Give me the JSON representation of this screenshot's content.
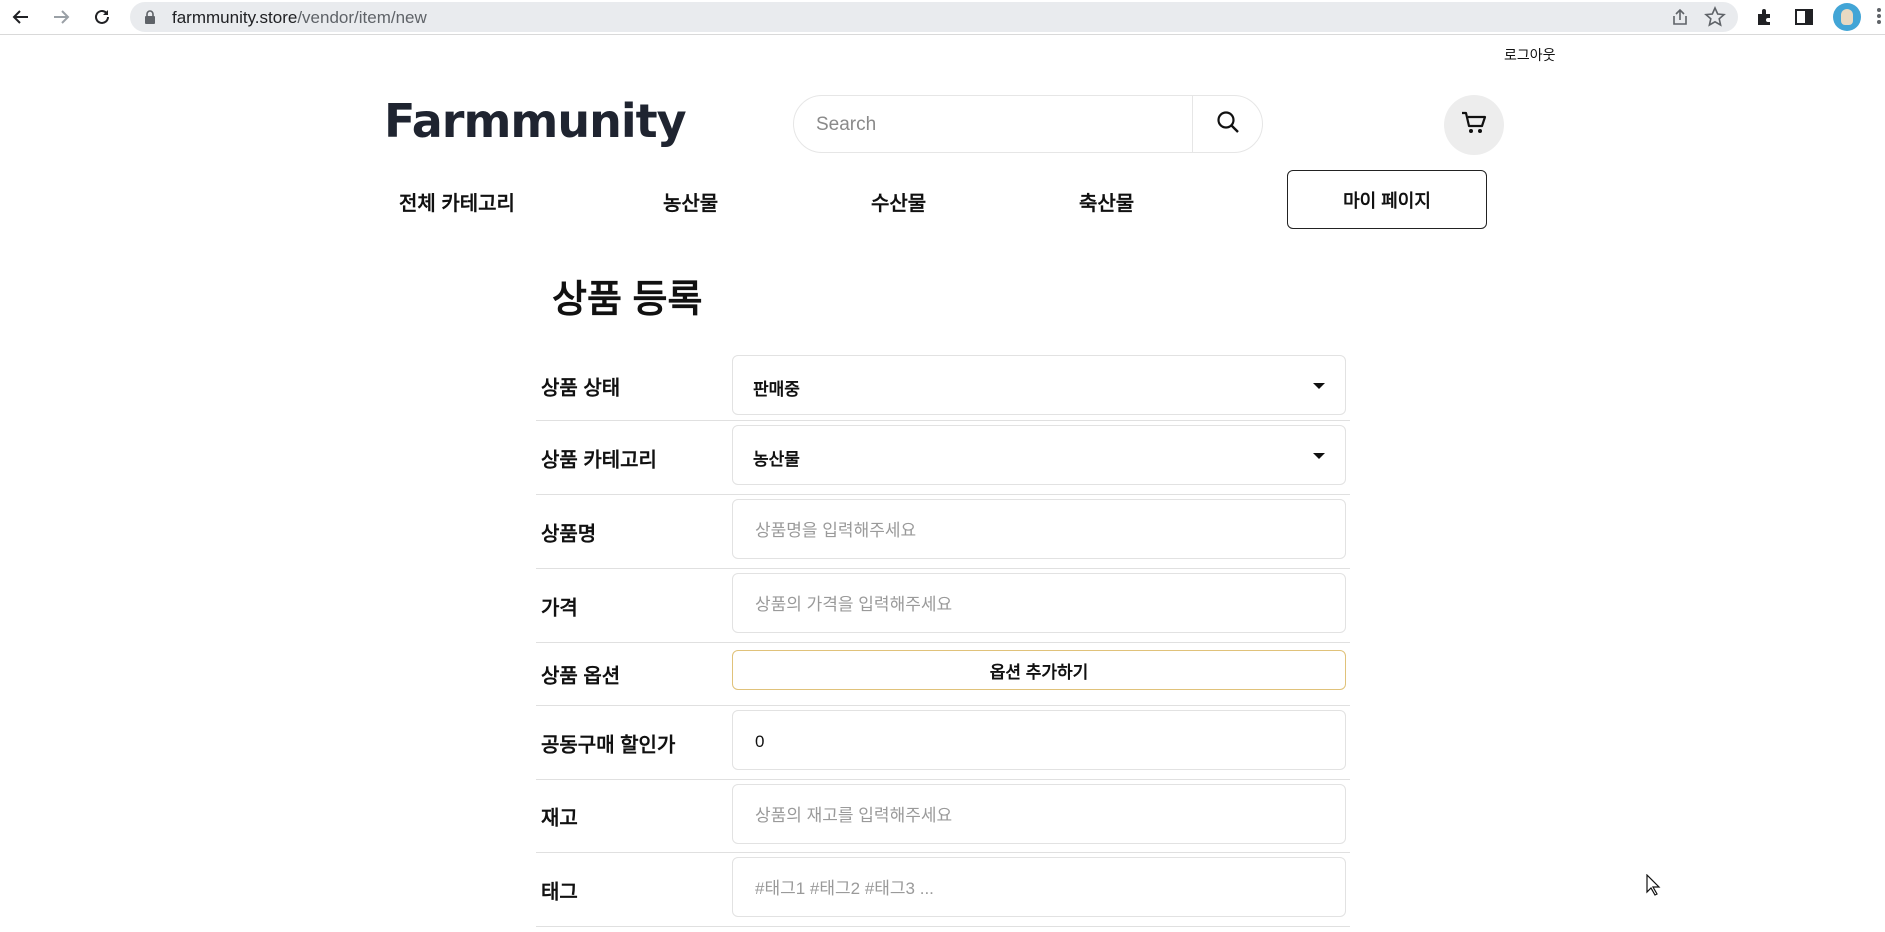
{
  "browser": {
    "url_host": "farmmunity.store",
    "url_path": "/vendor/item/new"
  },
  "header": {
    "logout_label": "로그아웃",
    "logo_text": "Farmmunity",
    "search_placeholder": "Search"
  },
  "gnb": {
    "items": [
      "전체 카테고리",
      "농산물",
      "수산물",
      "축산물"
    ],
    "mypage_label": "마이 페이지"
  },
  "form": {
    "title": "상품 등록",
    "status": {
      "label": "상품 상태",
      "value": "판매중"
    },
    "category": {
      "label": "상품 카테고리",
      "value": "농산물"
    },
    "name": {
      "label": "상품명",
      "placeholder": "상품명을 입력해주세요"
    },
    "price": {
      "label": "가격",
      "placeholder": "상품의 가격을 입력해주세요"
    },
    "options": {
      "label": "상품 옵션",
      "button_label": "옵션 추가하기"
    },
    "group_discount": {
      "label": "공동구매 할인가",
      "value": "0"
    },
    "stock": {
      "label": "재고",
      "placeholder": "상품의 재고를 입력해주세요"
    },
    "tags": {
      "label": "태그",
      "placeholder": "#태그1 #태그2 #태그3 ..."
    }
  },
  "colors": {
    "logo": "#1f2430",
    "option_border": "#e0c27a",
    "profile": "#42a5d6"
  },
  "icons": [
    "back-icon",
    "forward-icon",
    "reload-icon",
    "lock-icon",
    "share-icon",
    "star-icon",
    "extensions-icon",
    "sidepanel-icon",
    "search-icon",
    "cart-icon",
    "chevron-down-icon",
    "cursor-icon"
  ]
}
